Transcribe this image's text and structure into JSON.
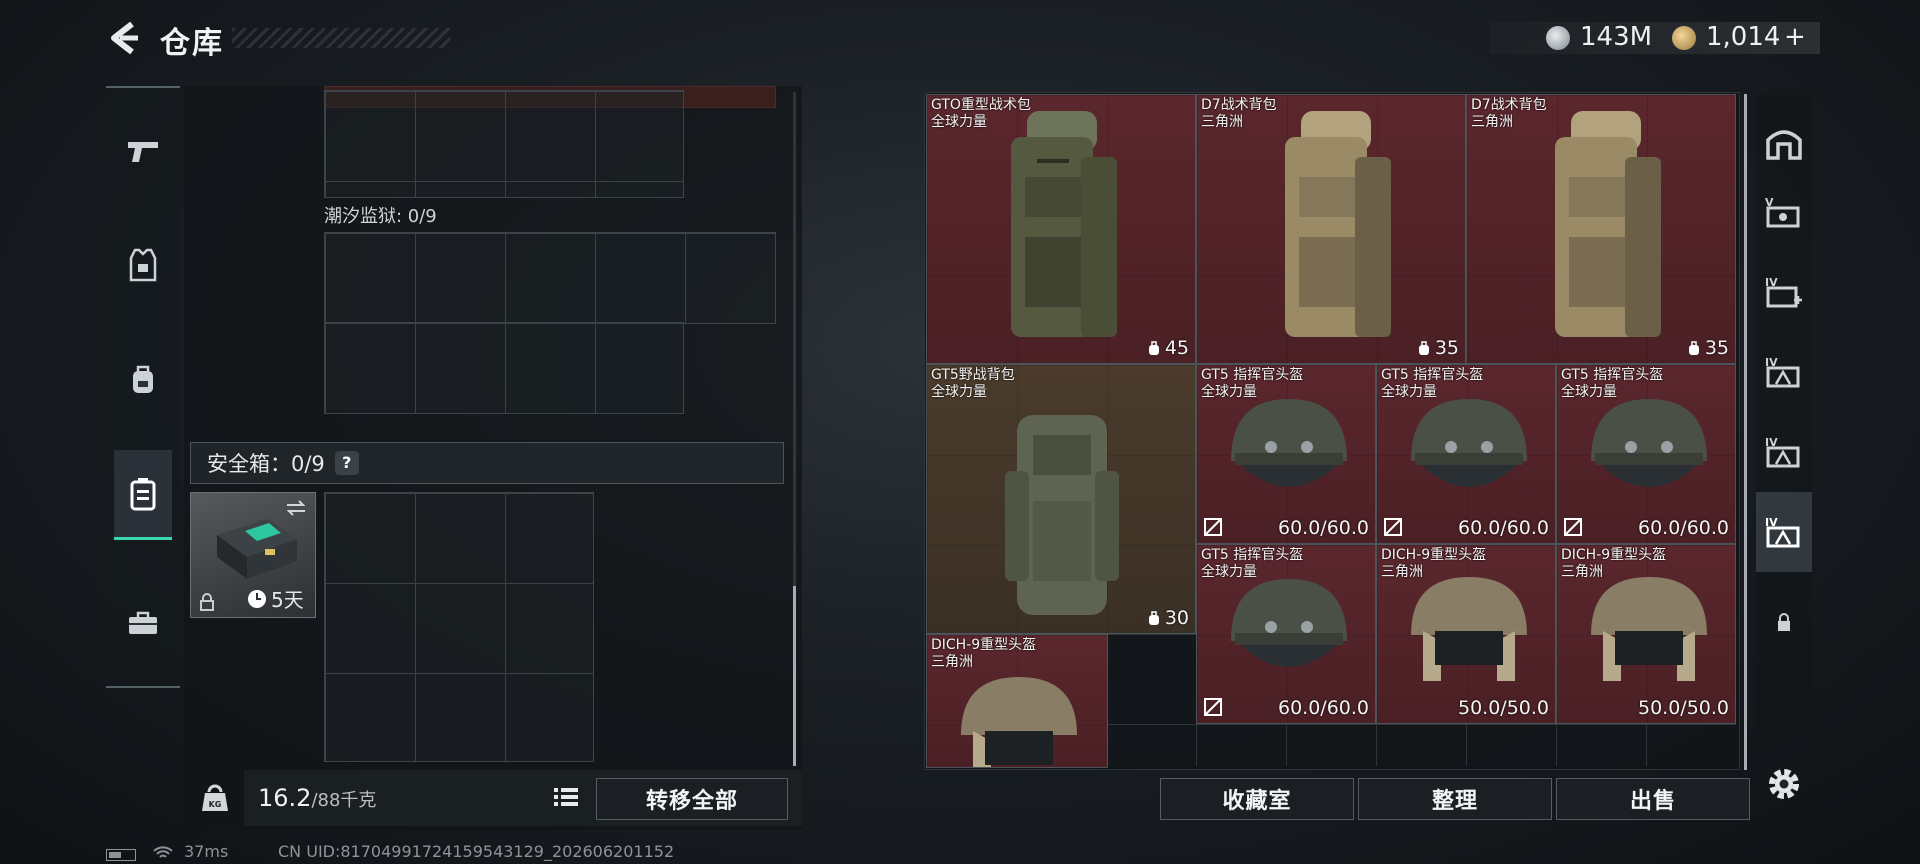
{
  "header": {
    "title": "仓库",
    "currency_1": "143M",
    "currency_2": "1,014",
    "currency_2_add": "+"
  },
  "left_nav": {
    "items": [
      "weapon-icon",
      "armor-icon",
      "backpack-icon",
      "container-icon",
      "toolbox-icon"
    ],
    "active_index": 3
  },
  "storage": {
    "tide_prison_label": "潮汐监狱: 0/9",
    "safe_box_label": "安全箱：0/9",
    "safe_box_help": "?",
    "safe_item_days": "5天"
  },
  "bottom_left": {
    "weight_value": "16.2",
    "weight_max": "/88千克",
    "transfer_all": "转移全部"
  },
  "status_bar": {
    "ping": "37ms",
    "uid": "CN UID:81704991724159543129_202606201152"
  },
  "inventory": {
    "items": [
      {
        "name": "GTO重型战术包",
        "sub": "全球力量",
        "stat": "45",
        "kind": "backpack"
      },
      {
        "name": "D7战术背包",
        "sub": "三角洲",
        "stat": "35",
        "kind": "backpack"
      },
      {
        "name": "D7战术背包",
        "sub": "三角洲",
        "stat": "35",
        "kind": "backpack"
      },
      {
        "name": "GT5野战背包",
        "sub": "全球力量",
        "stat": "30",
        "kind": "backpack"
      },
      {
        "name": "GT5 指挥官头盔",
        "sub": "全球力量",
        "stat": "60.0/60.0",
        "kind": "helmet"
      },
      {
        "name": "GT5 指挥官头盔",
        "sub": "全球力量",
        "stat": "60.0/60.0",
        "kind": "helmet"
      },
      {
        "name": "GT5 指挥官头盔",
        "sub": "全球力量",
        "stat": "60.0/60.0",
        "kind": "helmet"
      },
      {
        "name": "GT5 指挥官头盔",
        "sub": "全球力量",
        "stat": "60.0/60.0",
        "kind": "helmet"
      },
      {
        "name": "DICH-9重型头盔",
        "sub": "三角洲",
        "stat": "50.0/50.0",
        "kind": "helmet"
      },
      {
        "name": "DICH-9重型头盔",
        "sub": "三角洲",
        "stat": "50.0/50.0",
        "kind": "helmet"
      },
      {
        "name": "DICH-9重型头盔",
        "sub": "三角洲",
        "stat": "",
        "kind": "helmet"
      }
    ]
  },
  "bottom_right": {
    "collection": "收藏室",
    "sort": "整理",
    "sell": "出售"
  },
  "colors": {
    "accent": "#3ad9b2",
    "item_red": "#5a272d",
    "item_brown": "#4a3b2b"
  }
}
